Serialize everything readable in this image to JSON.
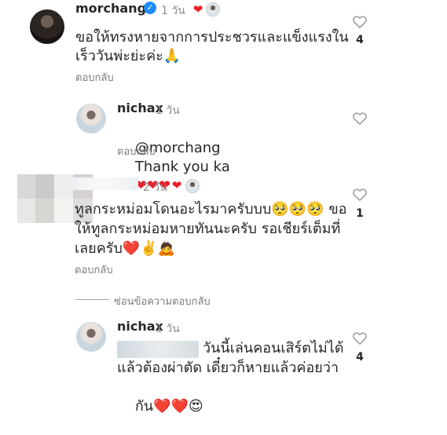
{
  "comments": [
    {
      "username": "morchang",
      "time": "1 วัน",
      "text_line1": "ขอให้ทรงหายจากการประชวรและแข็งแรงใน",
      "text_line2": "เร็ววันพ่ะย่ะค่ะ🙏",
      "reply": "ตอบกลับ",
      "likes": "4"
    },
    {
      "username": "nichax",
      "time": "1 วัน",
      "mention": "@morchang",
      "text": "Thank you ka",
      "hearts": "❤❤❤",
      "reply": "ตอบกลับ"
    },
    {
      "time": "2 วัน",
      "text_line1": "ทูลกระหม่อมโดนอะไรมาครับบบ🥺🥺🥺 ขอ",
      "text_line2": "ให้ทูลกระหม่อมหายทันนะครับ รอเชียร์เต็มที่",
      "text_line3": "เลยครับ❤️✌️🙇",
      "reply": "ตอบกลับ",
      "likes": "1",
      "hide_replies": "ซ่อนข้อความตอบกลับ"
    },
    {
      "username": "nichax",
      "time": "1 วัน",
      "text_line1": "วันนี้เล่นคอนเสิร์ตไม่ได้",
      "text_line2": "แล้วต้องผ่าตัด เดี๋ยวก็หายแล้วค่อยว่า",
      "text_line3": "กัน",
      "emoji_end": "❤️❤️😍",
      "likes": "4"
    }
  ],
  "icons": {
    "heart": "heart-icon",
    "verified": "verified-badge-icon",
    "like": "like-outline-icon"
  },
  "colors": {
    "accent_blue": "#1d8cf8",
    "heart_red": "#ed1c24",
    "muted_text": "#8e8e8e"
  }
}
